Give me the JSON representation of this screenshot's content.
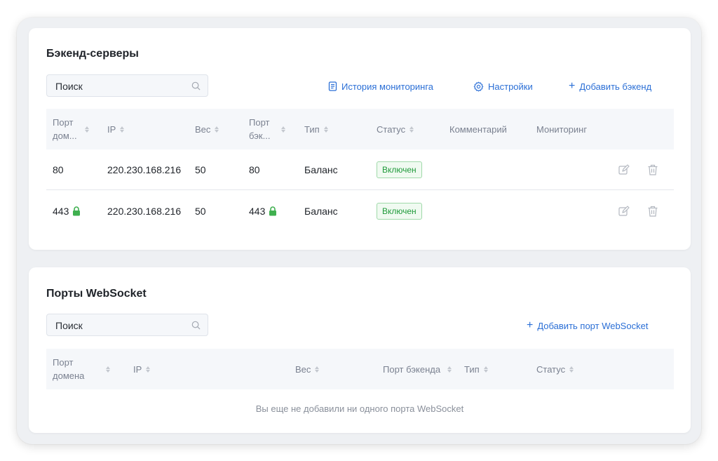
{
  "backend": {
    "title": "Бэкенд-серверы",
    "search_placeholder": "Поиск",
    "history_label": "История мониторинга",
    "settings_label": "Настройки",
    "add_label": "Добавить бэкенд",
    "columns": [
      "Порт дом...",
      "IP",
      "Вес",
      "Порт бэк...",
      "Тип",
      "Статус",
      "Комментарий",
      "Мониторинг"
    ],
    "rows": [
      {
        "domain_port": "80",
        "ip": "220.230.168.216",
        "weight": "50",
        "backend_port": "80",
        "type": "Баланс",
        "status": "Включен",
        "comment": "",
        "monitoring": ""
      },
      {
        "domain_port": "443",
        "ip": "220.230.168.216",
        "weight": "50",
        "backend_port": "443",
        "type": "Баланс",
        "status": "Включен",
        "comment": "",
        "monitoring": ""
      }
    ]
  },
  "websocket": {
    "title": "Порты WebSocket",
    "search_placeholder": "Поиск",
    "add_label": "Добавить порт WebSocket",
    "columns": [
      "Порт домена",
      "IP",
      "Вес",
      "Порт бэкенда",
      "Тип",
      "Статус"
    ],
    "empty_text": "Вы еще не добавили ни одного порта WebSocket"
  },
  "colors": {
    "accent": "#2b6fd6",
    "status_ok": "#1f9a3a",
    "lock": "#3fb04f"
  },
  "icons": [
    "search-icon",
    "document-icon",
    "gear-icon",
    "plus-icon",
    "lock-icon",
    "edit-icon",
    "trash-icon",
    "sort-icon"
  ]
}
